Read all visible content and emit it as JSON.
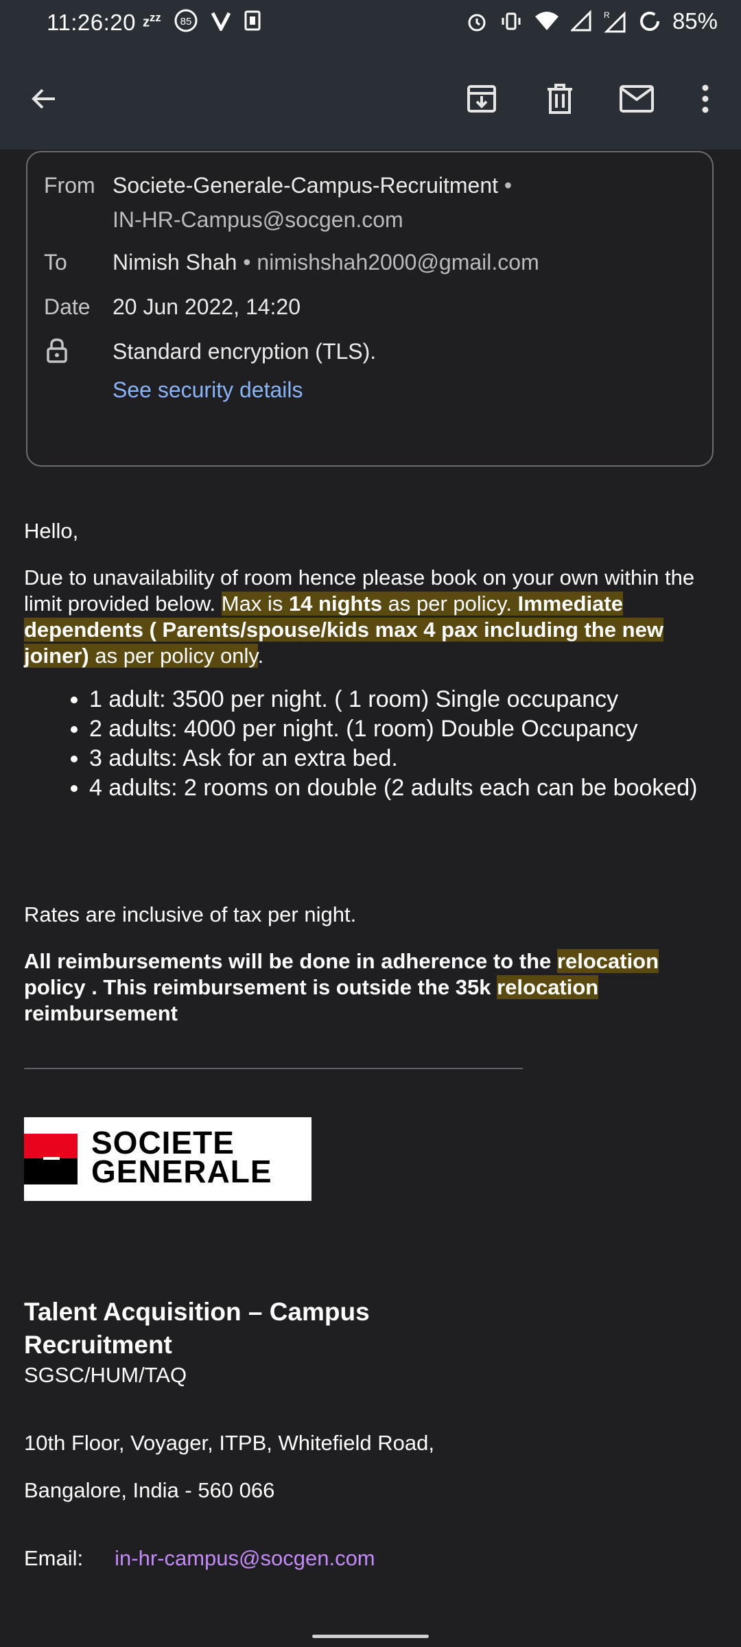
{
  "status_bar": {
    "time": "11:26:20",
    "left_icons": [
      "sleep-zzz-icon",
      "notification-85-icon",
      "vivaldi-v-icon",
      "sim-icon"
    ],
    "right_icons": [
      "alarm-icon",
      "vibrate-icon",
      "wifi-icon",
      "signal-icon",
      "signal-roaming-icon",
      "battery-ring-icon"
    ],
    "battery": "85%"
  },
  "toolbar": {
    "back": "back-arrow-icon",
    "actions": [
      "archive-icon",
      "delete-icon",
      "mark-unread-icon",
      "more-vert-icon"
    ]
  },
  "details": {
    "from_label": "From",
    "from_name": "Societe-Generale-Campus-Recruitment",
    "from_sep": " •",
    "from_email": "IN-HR-Campus@socgen.com",
    "to_label": "To",
    "to_name": "Nimish Shah",
    "to_sep": " • ",
    "to_email": "nimishshah2000@gmail.com",
    "date_label": "Date",
    "date_value": "20 Jun 2022, 14:20",
    "encryption_text": "Standard encryption (TLS).",
    "security_link": "See security details"
  },
  "email": {
    "greeting": "Hello,",
    "para1_a": "Due to unavailability of room hence please book on your own within the limit provided below. ",
    "para1_b": "Max is ",
    "para1_c": "14 nights",
    "para1_d": " as per policy. ",
    "para1_e": "Immediate dependents ( Parents/spouse/kids max 4 pax including the new joiner)",
    "para1_f": " as per policy only",
    "para1_g": ".",
    "bullets": [
      "1 adult: 3500 per night. ( 1 room) Single occupancy",
      "2 adults: 4000 per night. (1 room) Double Occupancy",
      "3 adults: Ask for an extra bed.",
      "4 adults: 2 rooms on double (2 adults each can be booked)"
    ],
    "rates_note": "Rates are inclusive of tax per night.",
    "reimb_a": "All reimbursements will be done in adherence to the ",
    "reimb_hl1": "relocation",
    "reimb_b": " policy . This reimbursement is outside the 35k ",
    "reimb_hl2": "relocation",
    "reimb_c": " reimbursement"
  },
  "signature": {
    "logo_line1": "SOCIETE",
    "logo_line2": "GENERALE",
    "title": "Talent Acquisition – Campus Recruitment",
    "dept": "SGSC/HUM/TAQ",
    "address1": "10th Floor, Voyager, ITPB, Whitefield Road,",
    "address2": "Bangalore, India - 560 066",
    "email_label": "Email:",
    "email_value": "in-hr-campus@socgen.com"
  },
  "colors": {
    "background": "#1f1f21",
    "toolbar": "#2a2e35",
    "link_blue": "#8ab4f8",
    "link_purple": "#c58af9",
    "highlight": "#5a4a10",
    "brand_red": "#e9041e"
  }
}
